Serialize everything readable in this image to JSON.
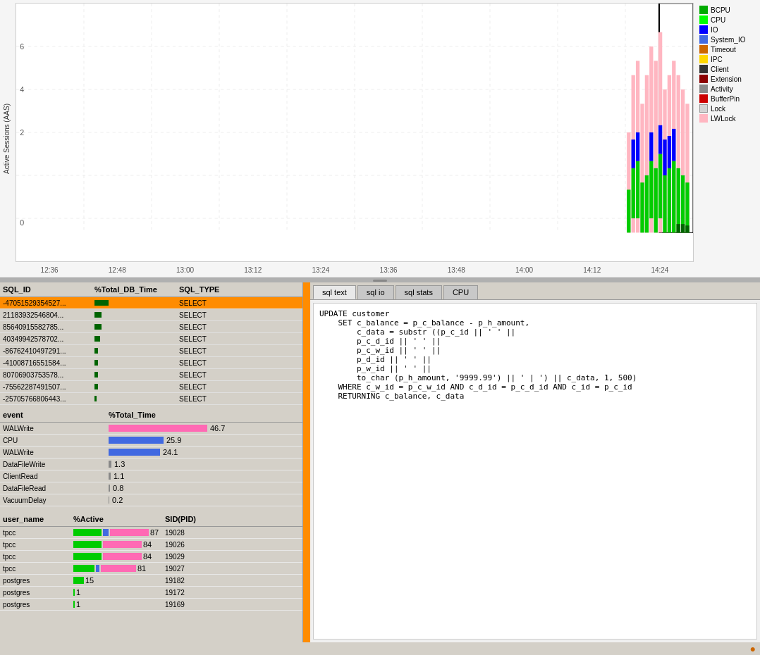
{
  "chart": {
    "yLabel": "Active Sessions (AAS)",
    "yTicks": [
      "6",
      "4",
      "2",
      "0"
    ],
    "xTicks": [
      "12:36",
      "12:48",
      "13:00",
      "13:12",
      "13:24",
      "13:36",
      "13:48",
      "14:00",
      "14:12",
      "14:24"
    ]
  },
  "legend": {
    "items": [
      {
        "label": "BCPU",
        "color": "#00aa00"
      },
      {
        "label": "CPU",
        "color": "#00ff00"
      },
      {
        "label": "IO",
        "color": "#0000ff"
      },
      {
        "label": "System_IO",
        "color": "#4169e1"
      },
      {
        "label": "Timeout",
        "color": "#cc6600"
      },
      {
        "label": "IPC",
        "color": "#ffd700"
      },
      {
        "label": "Client",
        "color": "#333333"
      },
      {
        "label": "Extension",
        "color": "#8b0000"
      },
      {
        "label": "Activity",
        "color": "#888888"
      },
      {
        "label": "BufferPin",
        "color": "#cc0000"
      },
      {
        "label": "Lock",
        "color": "#d3d3d3"
      },
      {
        "label": "LWLock",
        "color": "#ffb6c1"
      }
    ]
  },
  "sqlTable": {
    "headers": [
      "SQL_ID",
      "%Total_DB_Time",
      "SQL_TYPE"
    ],
    "rows": [
      {
        "id": "-47051529354527...",
        "pct": 8,
        "type": "SELECT",
        "selected": true
      },
      {
        "id": "21183932546804...",
        "pct": 4,
        "type": "SELECT",
        "selected": false
      },
      {
        "id": "85640915582785...",
        "pct": 4,
        "type": "SELECT",
        "selected": false
      },
      {
        "id": "40349942578702...",
        "pct": 3,
        "type": "SELECT",
        "selected": false
      },
      {
        "id": "-86762410497291...",
        "pct": 2,
        "type": "SELECT",
        "selected": false
      },
      {
        "id": "-41008716551584...",
        "pct": 2,
        "type": "SELECT",
        "selected": false
      },
      {
        "id": "80706903753578...",
        "pct": 2,
        "type": "SELECT",
        "selected": false
      },
      {
        "id": "-75562287491507...",
        "pct": 2,
        "type": "SELECT",
        "selected": false
      },
      {
        "id": "-25705766806443...",
        "pct": 1,
        "type": "SELECT",
        "selected": false
      }
    ]
  },
  "eventTable": {
    "headers": [
      "event",
      "%Total_Time"
    ],
    "rows": [
      {
        "event": "WALWrite",
        "pct": 46.7,
        "barType": "pink",
        "barWidth": 140
      },
      {
        "event": "CPU",
        "pct": 25.9,
        "barType": "blue",
        "barWidth": 78
      },
      {
        "event": "WALWrite",
        "pct": 24.1,
        "barType": "blue",
        "barWidth": 73
      },
      {
        "event": "DataFileWrite",
        "pct": 1.3,
        "barType": "gray",
        "barWidth": 4
      },
      {
        "event": "ClientRead",
        "pct": 1.1,
        "barType": "gray",
        "barWidth": 3
      },
      {
        "event": "DataFileRead",
        "pct": 0.8,
        "barType": "gray",
        "barWidth": 2
      },
      {
        "event": "VacuumDelay",
        "pct": 0.2,
        "barType": "gray",
        "barWidth": 1
      }
    ]
  },
  "userTable": {
    "headers": [
      "user_name",
      "%Active",
      "SID(PID)"
    ],
    "rows": [
      {
        "user": "tpcc",
        "active": 87,
        "sid": "19028",
        "bars": [
          {
            "color": "#00cc00",
            "w": 40
          },
          {
            "color": "#4169e1",
            "w": 8
          },
          {
            "color": "#ff69b4",
            "w": 55
          }
        ]
      },
      {
        "user": "tpcc",
        "active": 84,
        "sid": "19026",
        "bars": [
          {
            "color": "#00cc00",
            "w": 40
          },
          {
            "color": "#ff69b4",
            "w": 55
          }
        ]
      },
      {
        "user": "tpcc",
        "active": 84,
        "sid": "19029",
        "bars": [
          {
            "color": "#00cc00",
            "w": 40
          },
          {
            "color": "#ff69b4",
            "w": 55
          }
        ]
      },
      {
        "user": "tpcc",
        "active": 81,
        "sid": "19027",
        "bars": [
          {
            "color": "#00cc00",
            "w": 30
          },
          {
            "color": "#4169e1",
            "w": 5
          },
          {
            "color": "#ff69b4",
            "w": 50
          }
        ]
      },
      {
        "user": "postgres",
        "active": 15,
        "sid": "19182",
        "bars": [
          {
            "color": "#00cc00",
            "w": 15
          }
        ]
      },
      {
        "user": "postgres",
        "active": 1,
        "sid": "19172",
        "bars": [
          {
            "color": "#00cc00",
            "w": 2
          }
        ]
      },
      {
        "user": "postgres",
        "active": 1,
        "sid": "19169",
        "bars": [
          {
            "color": "#00cc00",
            "w": 2
          }
        ]
      }
    ]
  },
  "sqlTabs": {
    "tabs": [
      "sql text",
      "sql io",
      "sql stats",
      "CPU"
    ],
    "activeTab": 0
  },
  "sqlText": {
    "lines": [
      "UPDATE customer",
      "    SET c_balance = p_c_balance - p_h_amount,",
      "        c_data = substr ((p_c_id || ' ' ||",
      "        p_c_d_id || ' ' ||",
      "        p_c_w_id || ' ' ||",
      "        p_d_id || ' ' ||",
      "        p_w_id || ' ' ||",
      "        to_char (p_h_amount, '9999.99') || ' | ') || c_data, 1, 500)",
      "    WHERE c_w_id = p_c_w_id AND c_d_id = p_c_d_id AND c_id = p_c_id",
      "    RETURNING c_balance, c_data"
    ]
  }
}
